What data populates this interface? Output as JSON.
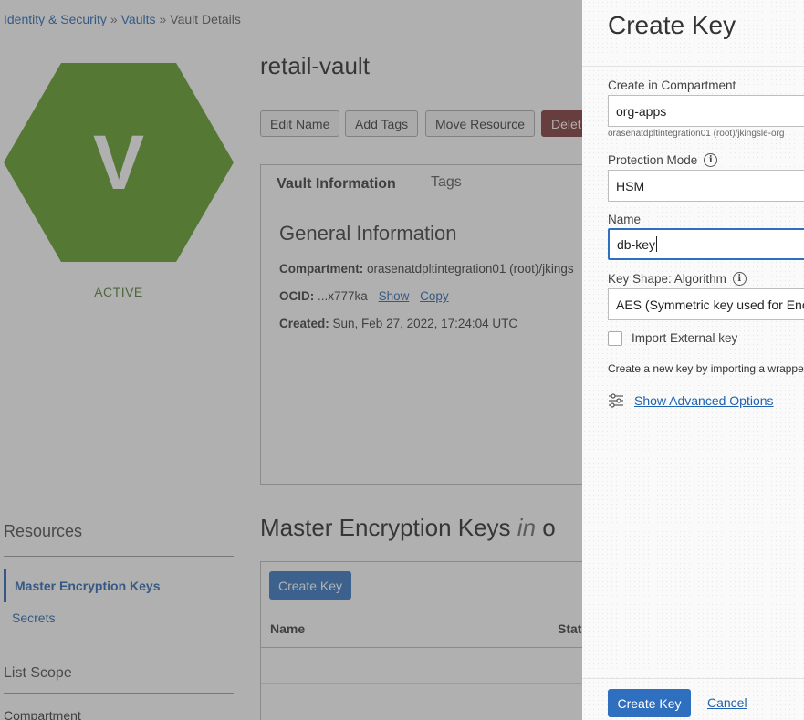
{
  "breadcrumb": {
    "items": [
      "Identity & Security",
      "Vaults",
      "Vault Details"
    ],
    "separator": "»"
  },
  "vault": {
    "initial": "V",
    "status": "ACTIVE",
    "name": "retail-vault",
    "hex_color": "#5a9a1f",
    "actions": {
      "edit_name": "Edit Name",
      "add_tags": "Add Tags",
      "move_resource": "Move Resource",
      "delete": "Delet"
    }
  },
  "info_tabs": {
    "active": "Vault Information",
    "other": "Tags"
  },
  "general_info": {
    "title": "General Information",
    "compartment_label": "Compartment:",
    "compartment_value": "orasenatdpltintegration01 (root)/jkings",
    "ocid_label": "OCID:",
    "ocid_value": "...x777ka",
    "show": "Show",
    "copy": "Copy",
    "created_label": "Created:",
    "created_value": "Sun, Feb 27, 2022, 17:24:04 UTC"
  },
  "resources": {
    "title": "Resources",
    "items": [
      "Master Encryption Keys",
      "Secrets"
    ],
    "list_scope": "List Scope",
    "compartment": "Compartment"
  },
  "keys_section": {
    "title_pre": "Master Encryption Keys",
    "title_in": "in",
    "title_post": "o",
    "create_button": "Create Key",
    "columns": [
      "Name",
      "Stat"
    ]
  },
  "panel": {
    "title": "Create Key",
    "compartment_label": "Create in Compartment",
    "compartment_value": "org-apps",
    "compartment_help": "orasenatdpltintegration01 (root)/jkingsle-org",
    "protection_label": "Protection Mode",
    "protection_value": "HSM",
    "name_label": "Name",
    "name_value": "db-key",
    "shape_label": "Key Shape: Algorithm",
    "shape_value": "AES (Symmetric key used for Enc",
    "import_label": "Import External key",
    "import_checked": false,
    "description": "Create a new key by importing a wrappe",
    "advanced": "Show Advanced Options",
    "create_button": "Create Key",
    "cancel": "Cancel"
  },
  "colors": {
    "accent": "#2f6fbf",
    "link": "#1f62b0",
    "delete": "#7a2e2e",
    "active_status": "#4d7a2a"
  }
}
